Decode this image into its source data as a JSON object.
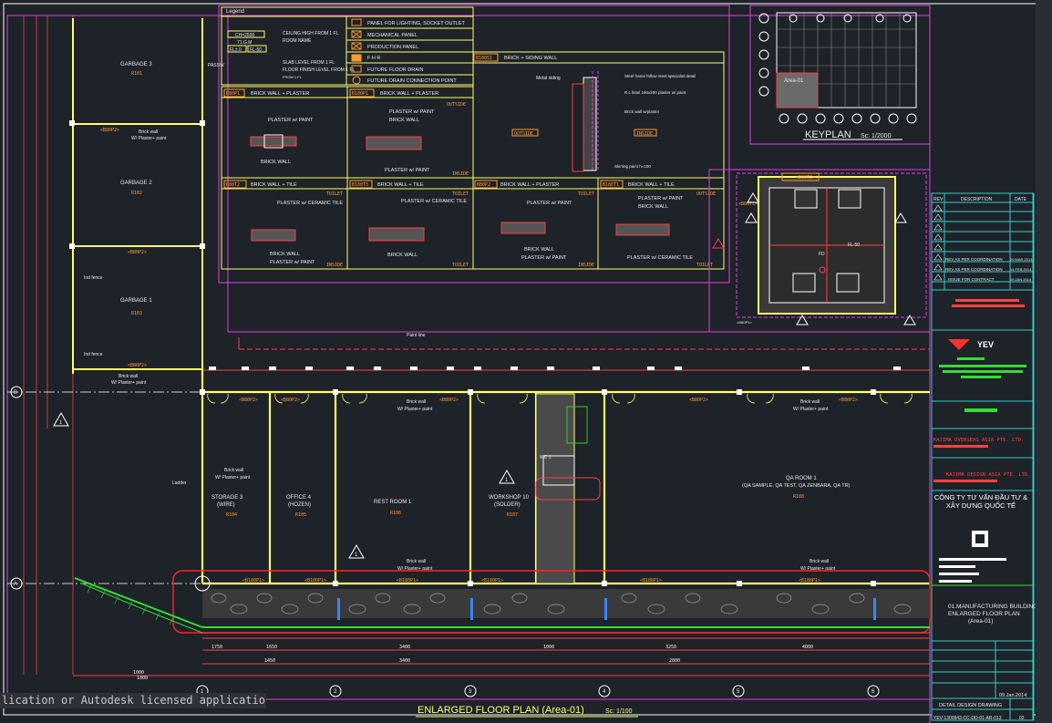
{
  "drawing": {
    "title": "ENLARGED FLOOR PLAN (Area-01)",
    "scale": "Sc: 1/100",
    "keyplan_title": "KEYPLAN",
    "keyplan_scale": "Sc: 1/2000",
    "keyplan_area": "Area-01"
  },
  "legend": {
    "title": "Legend",
    "tags": {
      "ch": "CH=2500",
      "rm": "71.G.M",
      "fl0": "FL± 0",
      "fl50": "FL-50"
    },
    "items": [
      "CEILING HIGH FROM 1 FL",
      "ROOM NAME",
      "SLAB LEVEL FROM 1 FL",
      "FLOOR FINISH LEVEL FROM 1 FL"
    ],
    "symbols": [
      "PANEL FOR LIGHTING, SOCKET OUTLET",
      "MECHANICAL PANEL",
      "PRODUCTION PANEL",
      "F H R",
      "FUTURE FLOOR DRAIN",
      "FUTURE DRAIN CONNECTION POINT"
    ]
  },
  "wall_types": {
    "w1": {
      "code": "B80P1",
      "label": "BRICK WALL + PLASTER",
      "note1": "PLASTER w/ PAINT",
      "note2": "BRICK WALL"
    },
    "w2": {
      "code": "B180P1",
      "label": "BRICK WALL + PLASTER",
      "note1": "PLASTER w/ PAINT",
      "note2": "BRICK WALL",
      "note3": "PLASTER w/ PAINT",
      "side": "OUTSIDE",
      "inside": "INSIDE"
    },
    "w3": {
      "code": "B180S1",
      "label": "BRICK + SIDING WALL",
      "metal": "Metal siding",
      "steel": "Steel frame follow steel specialist detail",
      "rc": "R.c lintel 180x200 plaster w/ paint",
      "brick": "Brick wall w/plaster",
      "skirting": "Skirting paint h=100",
      "outside": "OUTSIDE",
      "inside": "INSIDE"
    },
    "w4": {
      "code": "B80T2",
      "label": "BRICK WALL + TILE",
      "note1": "PLASTER w/ CERAMIC TILE",
      "note2": "BRICK WALL",
      "note3": "PLASTER w/ PAINT",
      "side": "TOILET",
      "inside": "INSIDE"
    },
    "w5": {
      "code": "B180T3",
      "label": "BRICK WALL + TILE",
      "note1": "PLASTER w/ CERAMIC TILE",
      "note2": "BRICK WALL",
      "side": "TOILET"
    },
    "w6": {
      "code": "B80P2",
      "label": "BRICK WALL + PLASTER",
      "note1": "PLASTER w/ PAINT",
      "note2": "BRICK WALL",
      "note3": "PLASTER w/ PAINT",
      "side": "TOILET",
      "inside": "INSIDE"
    },
    "w7": {
      "code": "B180T1",
      "label": "BRICK WALL + TILE",
      "note1": "PLASTER w/ PAINT",
      "note2": "BRICK WALL",
      "note3": "PLASTER w/ CERAMIC TILE",
      "side": "OUTSIDE",
      "inside": "TOILET"
    }
  },
  "rooms": [
    {
      "name": "GARBAGE 3",
      "id": "R101"
    },
    {
      "name": "GARBAGE 2",
      "id": "R102"
    },
    {
      "name": "GARBAGE 1",
      "id": "R103"
    },
    {
      "name": "STORAGE 3",
      "sub": "(WIRE)",
      "id": "R104"
    },
    {
      "name": "OFFICE 4",
      "sub": "(HOZEN)",
      "id": "R105"
    },
    {
      "name": "REST ROOM 1",
      "sub": "",
      "id": "R106"
    },
    {
      "name": "WORKSHOP 10",
      "sub": "(SOLDER)",
      "id": "R107"
    },
    {
      "name": "QA ROOM 1",
      "sub": "(QA SAMPLE, QA TEST, QA ZENBARA, QA TR)",
      "id": "R108"
    }
  ],
  "notes": {
    "brick_wall": "Brick wall",
    "plaster_paint": "W/ Plaster+ paint",
    "paint_line": "Paint line",
    "ladder": "Ladder",
    "fence": "Ind fence",
    "passage": "PASSW",
    "wc": "WC 1"
  },
  "wall_tags": [
    "<B80P2>",
    "<B80P2>",
    "<B80P2>",
    "<B180P1>",
    "<B180P1>",
    "<B180P1>",
    "<B80P1>",
    "<B80T2>",
    "<B80T1>"
  ],
  "dims": [
    "1750",
    "1650",
    "3400",
    "1000",
    "3250",
    "4000",
    "1450",
    "2800"
  ],
  "grid": {
    "axis_a": "A",
    "axis_b": "B",
    "cols": [
      "1",
      "2",
      "3",
      "4",
      "5",
      "6"
    ]
  },
  "title_block": {
    "rev_h": [
      "REV",
      "DESCRIPTION",
      "DATE"
    ],
    "rev_rows": [
      {
        "rev": "",
        "desc": "REV AS PER COORDINATION",
        "date": "29.MAR.2014"
      },
      {
        "rev": "",
        "desc": "REV AS PER COORDINATION",
        "date": "14.FEB.2014"
      },
      {
        "rev": "",
        "desc": "ISSUE FOR CONTRACT",
        "date": "09.JAN.2014"
      }
    ],
    "owner": "YEV",
    "consultant": "CÔNG TY TƯ VẤN ĐẦU TƯ & XÂY DỰNG QUỐC TẾ",
    "contractor": "KAJIMA OVERSEAS ASIA PTE. LTD.",
    "design_coord": "KAJIMA DESIGN ASIA PTE. LTD.",
    "drawing_title_1": "01.MANUFACTURING BUILDING",
    "drawing_title_2": "ENLARGED FLOOR PLAN",
    "drawing_title_3": "(Area-01)",
    "date": "09.Jan.2014",
    "stage": "DETAIL DESIGN DRAWING",
    "number": "YEV-1300943-CC-DD-01-AR-013",
    "revision": "02"
  },
  "status_text": "lication or Autodesk licensed application.",
  "colors": {
    "bg": "#1e2229",
    "wall": "#ffff66",
    "dim": "#ff4040",
    "tag": "#ff9933",
    "frame": "#e040e0",
    "green": "#33dd33",
    "cyan": "#33cccc",
    "text": "#f2f2f2"
  }
}
